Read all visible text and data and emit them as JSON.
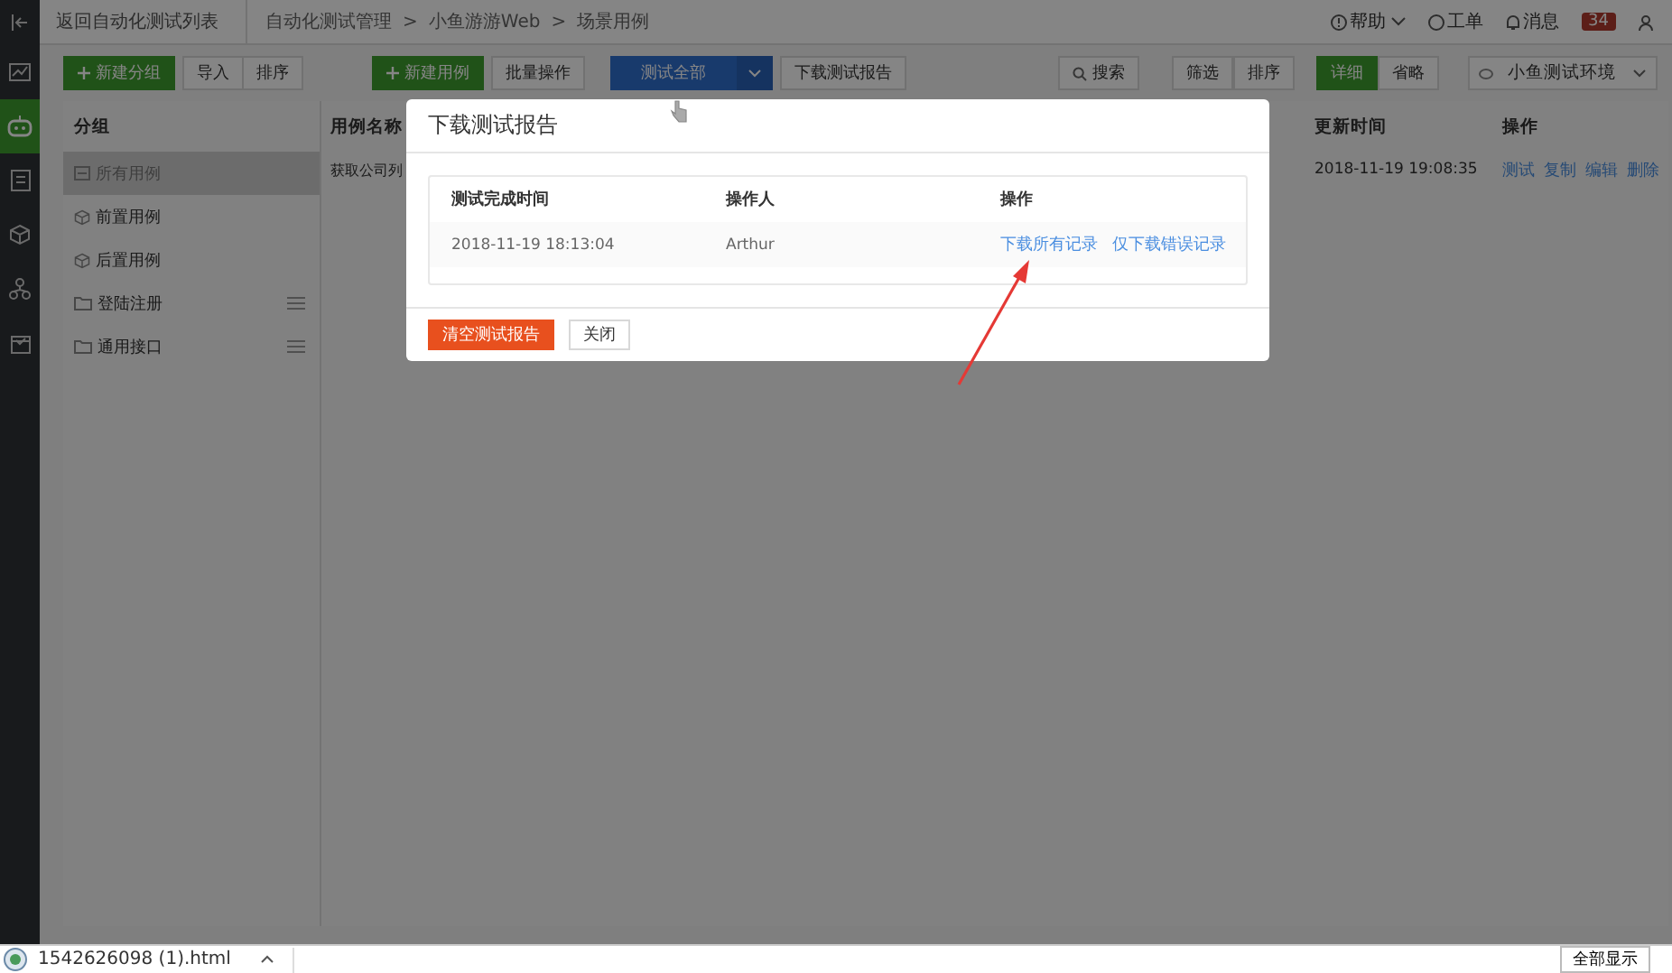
{
  "rail": {
    "items": [
      {
        "selected": false
      },
      {
        "selected": true
      },
      {
        "selected": false
      },
      {
        "selected": false
      },
      {
        "selected": false
      },
      {
        "selected": false
      }
    ]
  },
  "header": {
    "back_link": "返回自动化测试列表",
    "breadcrumb": [
      "自动化测试管理",
      "小鱼游游Web",
      "场景用例"
    ],
    "separator": ">",
    "help": "帮助",
    "ticket": "工单",
    "messages": "消息",
    "badge": "34"
  },
  "toolbar": {
    "new_group": "新建分组",
    "import": "导入",
    "sort": "排序",
    "new_case": "新建用例",
    "batch": "批量操作",
    "test_all": "测试全部",
    "download_report": "下载测试报告",
    "search": "搜索",
    "filter": "筛选",
    "sort_right": "排序",
    "views": [
      {
        "label": "详细",
        "selected": true
      },
      {
        "label": "省略",
        "selected": false
      }
    ],
    "environment": "小鱼测试环境"
  },
  "groups": {
    "title": "分组",
    "items": [
      {
        "label": "所有用例",
        "kind": "all",
        "selected": true
      },
      {
        "label": "前置用例",
        "kind": "case",
        "selected": false
      },
      {
        "label": "后置用例",
        "kind": "case",
        "selected": false
      },
      {
        "label": "登陆注册",
        "kind": "folder",
        "selected": false
      },
      {
        "label": "通用接口",
        "kind": "folder",
        "selected": false
      }
    ]
  },
  "table": {
    "columns": [
      "用例名称",
      "更新时间",
      "操作"
    ],
    "rows": [
      {
        "name": "获取公司列",
        "updated": "2018-11-19 19:08:35",
        "actions": [
          "测试",
          "复制",
          "编辑",
          "删除"
        ]
      }
    ]
  },
  "modal": {
    "title": "下载测试报告",
    "columns": [
      "测试完成时间",
      "操作人",
      "操作"
    ],
    "rows": [
      {
        "time": "2018-11-19 18:13:04",
        "operator": "Arthur",
        "actions": [
          "下载所有记录",
          "仅下载错误记录"
        ]
      }
    ],
    "buttons": [
      {
        "label": "清空测试报告",
        "kind": "danger"
      },
      {
        "label": "关闭",
        "kind": "default"
      }
    ]
  },
  "download_bar": {
    "file": "1542626098 (1).html",
    "show_all": "全部显示"
  }
}
